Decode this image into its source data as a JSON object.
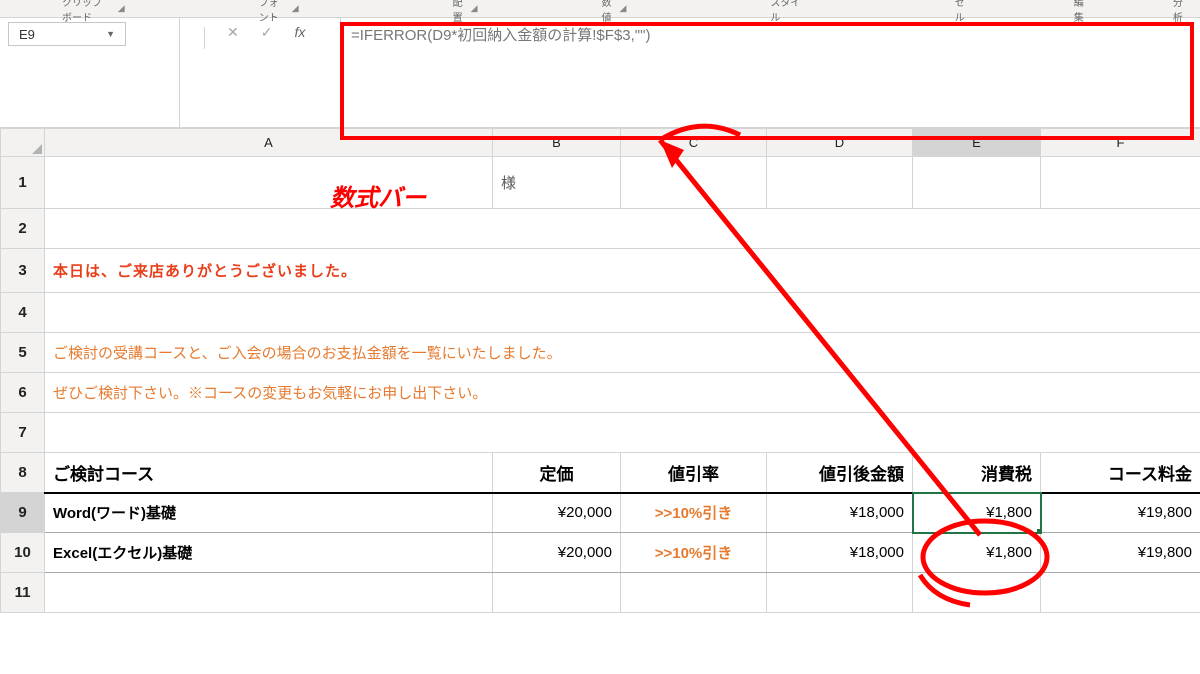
{
  "ribbon": {
    "groups": [
      "クリップボード",
      "フォント",
      "配置",
      "数値",
      "スタイル",
      "セル",
      "編集",
      "分析"
    ]
  },
  "name_box": {
    "value": "E9"
  },
  "formula_bar": {
    "cancel": "✕",
    "enter": "✓",
    "fx": "fx",
    "formula": "=IFERROR(D9*初回納入金額の計算!$F$3,\"\")"
  },
  "columns": [
    "A",
    "B",
    "C",
    "D",
    "E",
    "F"
  ],
  "rows": [
    "1",
    "2",
    "3",
    "4",
    "5",
    "6",
    "7",
    "8",
    "9",
    "10",
    "11"
  ],
  "cells": {
    "B1": "様",
    "A3": "本日は、ご来店ありがとうございました。",
    "A5": "ご検討の受講コースと、ご入会の場合のお支払金額を一覧にいたしました。",
    "A6": "ぜひご検討下さい。※コースの変更もお気軽にお申し出下さい。"
  },
  "table": {
    "headers": [
      "ご検討コース",
      "定価",
      "値引率",
      "値引後金額",
      "消費税",
      "コース料金"
    ],
    "rows": [
      {
        "course": "Word(ワード)基礎",
        "price": "¥20,000",
        "discount": ">>10%引き",
        "after": "¥18,000",
        "tax": "¥1,800",
        "total": "¥19,800"
      },
      {
        "course": "Excel(エクセル)基礎",
        "price": "¥20,000",
        "discount": ">>10%引き",
        "after": "¥18,000",
        "tax": "¥1,800",
        "total": "¥19,800"
      }
    ]
  },
  "annotation": {
    "label": "数式バー"
  }
}
